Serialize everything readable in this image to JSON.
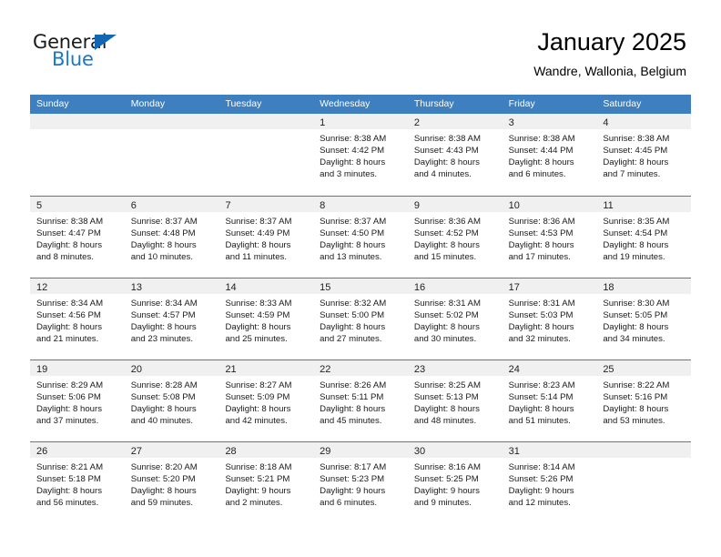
{
  "brand": {
    "name_part1": "General",
    "name_part2": "Blue",
    "accent_color": "#1878c8",
    "triangle_color": "#1167b1"
  },
  "header": {
    "title": "January 2025",
    "subtitle": "Wandre, Wallonia, Belgium",
    "header_bg_color": "#3d7fbf"
  },
  "weekdays": [
    "Sunday",
    "Monday",
    "Tuesday",
    "Wednesday",
    "Thursday",
    "Friday",
    "Saturday"
  ],
  "labels": {
    "sunrise_prefix": "Sunrise:",
    "sunset_prefix": "Sunset:",
    "daylight_prefix": "Daylight:"
  },
  "weeks": [
    [
      {
        "day": "",
        "empty": true,
        "lines": []
      },
      {
        "day": "",
        "empty": true,
        "lines": []
      },
      {
        "day": "",
        "empty": true,
        "lines": []
      },
      {
        "day": "1",
        "empty": false,
        "lines": [
          "Sunrise: 8:38 AM",
          "Sunset: 4:42 PM",
          "Daylight: 8 hours",
          "and 3 minutes."
        ]
      },
      {
        "day": "2",
        "empty": false,
        "lines": [
          "Sunrise: 8:38 AM",
          "Sunset: 4:43 PM",
          "Daylight: 8 hours",
          "and 4 minutes."
        ]
      },
      {
        "day": "3",
        "empty": false,
        "lines": [
          "Sunrise: 8:38 AM",
          "Sunset: 4:44 PM",
          "Daylight: 8 hours",
          "and 6 minutes."
        ]
      },
      {
        "day": "4",
        "empty": false,
        "lines": [
          "Sunrise: 8:38 AM",
          "Sunset: 4:45 PM",
          "Daylight: 8 hours",
          "and 7 minutes."
        ]
      }
    ],
    [
      {
        "day": "5",
        "empty": false,
        "lines": [
          "Sunrise: 8:38 AM",
          "Sunset: 4:47 PM",
          "Daylight: 8 hours",
          "and 8 minutes."
        ]
      },
      {
        "day": "6",
        "empty": false,
        "lines": [
          "Sunrise: 8:37 AM",
          "Sunset: 4:48 PM",
          "Daylight: 8 hours",
          "and 10 minutes."
        ]
      },
      {
        "day": "7",
        "empty": false,
        "lines": [
          "Sunrise: 8:37 AM",
          "Sunset: 4:49 PM",
          "Daylight: 8 hours",
          "and 11 minutes."
        ]
      },
      {
        "day": "8",
        "empty": false,
        "lines": [
          "Sunrise: 8:37 AM",
          "Sunset: 4:50 PM",
          "Daylight: 8 hours",
          "and 13 minutes."
        ]
      },
      {
        "day": "9",
        "empty": false,
        "lines": [
          "Sunrise: 8:36 AM",
          "Sunset: 4:52 PM",
          "Daylight: 8 hours",
          "and 15 minutes."
        ]
      },
      {
        "day": "10",
        "empty": false,
        "lines": [
          "Sunrise: 8:36 AM",
          "Sunset: 4:53 PM",
          "Daylight: 8 hours",
          "and 17 minutes."
        ]
      },
      {
        "day": "11",
        "empty": false,
        "lines": [
          "Sunrise: 8:35 AM",
          "Sunset: 4:54 PM",
          "Daylight: 8 hours",
          "and 19 minutes."
        ]
      }
    ],
    [
      {
        "day": "12",
        "empty": false,
        "lines": [
          "Sunrise: 8:34 AM",
          "Sunset: 4:56 PM",
          "Daylight: 8 hours",
          "and 21 minutes."
        ]
      },
      {
        "day": "13",
        "empty": false,
        "lines": [
          "Sunrise: 8:34 AM",
          "Sunset: 4:57 PM",
          "Daylight: 8 hours",
          "and 23 minutes."
        ]
      },
      {
        "day": "14",
        "empty": false,
        "lines": [
          "Sunrise: 8:33 AM",
          "Sunset: 4:59 PM",
          "Daylight: 8 hours",
          "and 25 minutes."
        ]
      },
      {
        "day": "15",
        "empty": false,
        "lines": [
          "Sunrise: 8:32 AM",
          "Sunset: 5:00 PM",
          "Daylight: 8 hours",
          "and 27 minutes."
        ]
      },
      {
        "day": "16",
        "empty": false,
        "lines": [
          "Sunrise: 8:31 AM",
          "Sunset: 5:02 PM",
          "Daylight: 8 hours",
          "and 30 minutes."
        ]
      },
      {
        "day": "17",
        "empty": false,
        "lines": [
          "Sunrise: 8:31 AM",
          "Sunset: 5:03 PM",
          "Daylight: 8 hours",
          "and 32 minutes."
        ]
      },
      {
        "day": "18",
        "empty": false,
        "lines": [
          "Sunrise: 8:30 AM",
          "Sunset: 5:05 PM",
          "Daylight: 8 hours",
          "and 34 minutes."
        ]
      }
    ],
    [
      {
        "day": "19",
        "empty": false,
        "lines": [
          "Sunrise: 8:29 AM",
          "Sunset: 5:06 PM",
          "Daylight: 8 hours",
          "and 37 minutes."
        ]
      },
      {
        "day": "20",
        "empty": false,
        "lines": [
          "Sunrise: 8:28 AM",
          "Sunset: 5:08 PM",
          "Daylight: 8 hours",
          "and 40 minutes."
        ]
      },
      {
        "day": "21",
        "empty": false,
        "lines": [
          "Sunrise: 8:27 AM",
          "Sunset: 5:09 PM",
          "Daylight: 8 hours",
          "and 42 minutes."
        ]
      },
      {
        "day": "22",
        "empty": false,
        "lines": [
          "Sunrise: 8:26 AM",
          "Sunset: 5:11 PM",
          "Daylight: 8 hours",
          "and 45 minutes."
        ]
      },
      {
        "day": "23",
        "empty": false,
        "lines": [
          "Sunrise: 8:25 AM",
          "Sunset: 5:13 PM",
          "Daylight: 8 hours",
          "and 48 minutes."
        ]
      },
      {
        "day": "24",
        "empty": false,
        "lines": [
          "Sunrise: 8:23 AM",
          "Sunset: 5:14 PM",
          "Daylight: 8 hours",
          "and 51 minutes."
        ]
      },
      {
        "day": "25",
        "empty": false,
        "lines": [
          "Sunrise: 8:22 AM",
          "Sunset: 5:16 PM",
          "Daylight: 8 hours",
          "and 53 minutes."
        ]
      }
    ],
    [
      {
        "day": "26",
        "empty": false,
        "lines": [
          "Sunrise: 8:21 AM",
          "Sunset: 5:18 PM",
          "Daylight: 8 hours",
          "and 56 minutes."
        ]
      },
      {
        "day": "27",
        "empty": false,
        "lines": [
          "Sunrise: 8:20 AM",
          "Sunset: 5:20 PM",
          "Daylight: 8 hours",
          "and 59 minutes."
        ]
      },
      {
        "day": "28",
        "empty": false,
        "lines": [
          "Sunrise: 8:18 AM",
          "Sunset: 5:21 PM",
          "Daylight: 9 hours",
          "and 2 minutes."
        ]
      },
      {
        "day": "29",
        "empty": false,
        "lines": [
          "Sunrise: 8:17 AM",
          "Sunset: 5:23 PM",
          "Daylight: 9 hours",
          "and 6 minutes."
        ]
      },
      {
        "day": "30",
        "empty": false,
        "lines": [
          "Sunrise: 8:16 AM",
          "Sunset: 5:25 PM",
          "Daylight: 9 hours",
          "and 9 minutes."
        ]
      },
      {
        "day": "31",
        "empty": false,
        "lines": [
          "Sunrise: 8:14 AM",
          "Sunset: 5:26 PM",
          "Daylight: 9 hours",
          "and 12 minutes."
        ]
      },
      {
        "day": "",
        "empty": true,
        "lines": []
      }
    ]
  ]
}
